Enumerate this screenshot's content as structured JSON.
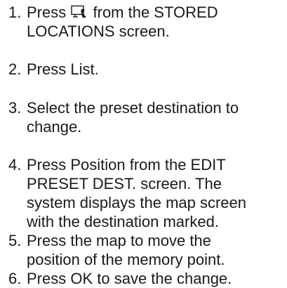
{
  "steps": [
    {
      "number": "1.",
      "lines": [
        "Press",
        "from the STORED",
        "LOCATIONS screen."
      ]
    },
    {
      "number": "2.",
      "lines": [
        "Press List."
      ]
    },
    {
      "number": "3.",
      "lines": [
        "Select the preset destination to",
        "change."
      ]
    },
    {
      "number": "4.",
      "lines": [
        "Press Position from the EDIT",
        "PRESET DEST. screen. The",
        "system displays the map screen",
        "with the destination marked."
      ]
    },
    {
      "number": "5.",
      "lines": [
        "Press the map to move the",
        "position of the memory point."
      ]
    },
    {
      "number": "6.",
      "lines": [
        "Press OK to save the change."
      ]
    }
  ],
  "icons": {
    "step1": "stored-locations-icon"
  }
}
